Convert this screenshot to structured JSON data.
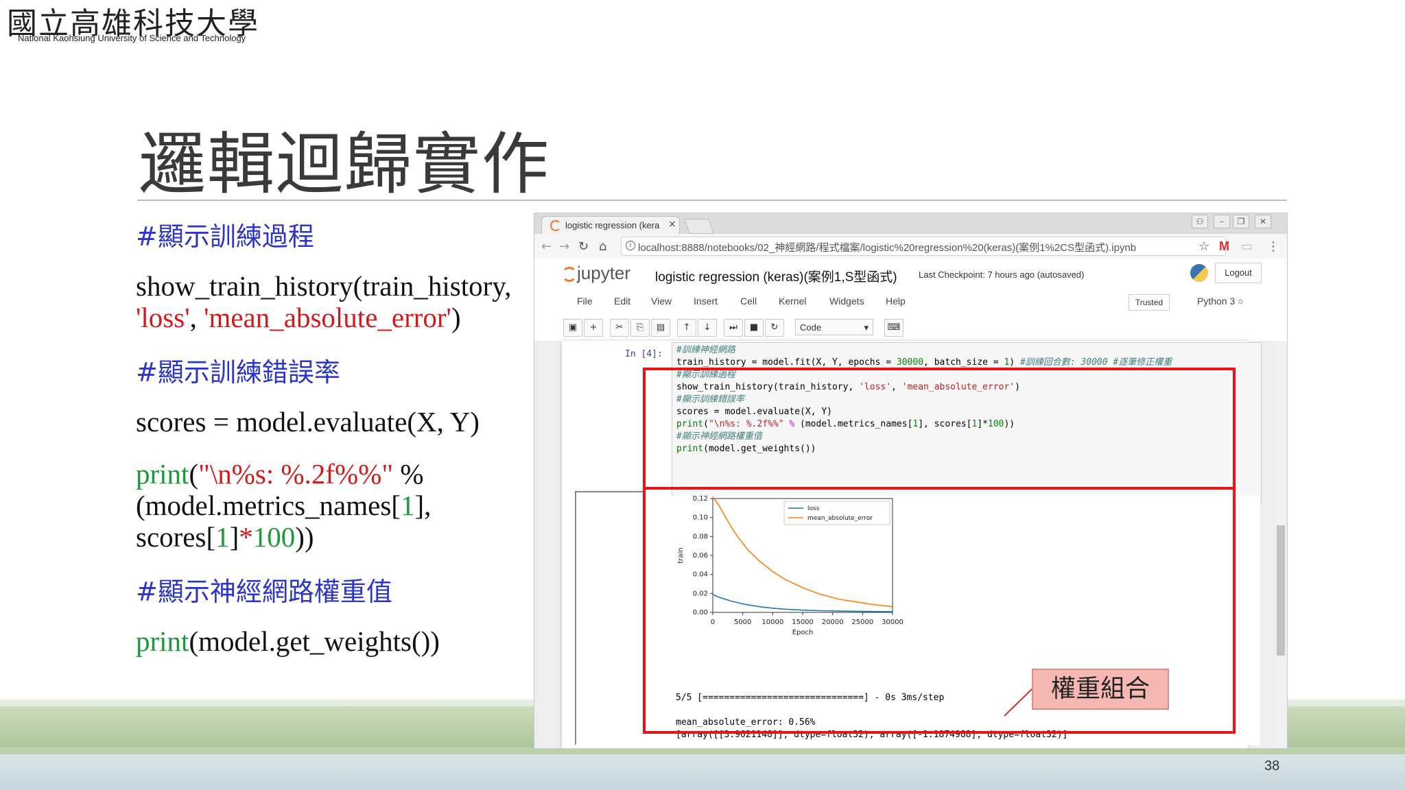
{
  "header": {
    "university_zh": "國立高雄科技大學",
    "university_en": "National Kaohsiung University of Science and Technology"
  },
  "slide": {
    "title": "邏輯迴歸實作",
    "page_number": "38",
    "comment1": "#顯示訓練過程",
    "line1": "show_train_history(train_history,",
    "line2_a": "'loss'",
    "line2_b": ", ",
    "line2_c": "'mean_absolute_error'",
    "line2_d": ")",
    "comment2": "#顯示訓練錯誤率",
    "line3": "scores = model.evaluate(X, Y)",
    "line4_a": "print",
    "line4_b": "(",
    "line4_c": "\"\\n%s: %.2f%%\"",
    "line4_d": " %",
    "line5_a": "(model.metrics_names[",
    "line5_b": "1",
    "line5_c": "],",
    "line6_a": "scores[",
    "line6_b": "1",
    "line6_c": "]",
    "line6_d": "*",
    "line6_e": "100",
    "line6_f": "))",
    "comment3": "#顯示神經網路權重值",
    "line7_a": "print",
    "line7_b": "(model.get_weights())",
    "callout": "權重組合"
  },
  "browser": {
    "tab_title": "logistic regression (kera",
    "tab_close": "×",
    "url": "localhost:8888/notebooks/02_神經網路/程式檔案/logistic%20regression%20(keras)(案例1%2CS型函式).ipynb",
    "url_info": "i",
    "jupyter_logo": "jupyter",
    "notebook_title": "logistic regression (keras)(案例1,S型函式)",
    "checkpoint": "Last Checkpoint: 7 hours ago (autosaved)",
    "logout": "Logout",
    "menus": [
      "File",
      "Edit",
      "View",
      "Insert",
      "Cell",
      "Kernel",
      "Widgets",
      "Help"
    ],
    "trusted": "Trusted",
    "kernel": "Python 3  ○",
    "cell_type": "Code",
    "cell_type_arrow": "▾",
    "toolbar_icons": [
      "save-icon",
      "plus-icon",
      "cut-icon",
      "copy-icon",
      "paste-icon",
      "arrow-up-icon",
      "arrow-down-icon",
      "step-forward-icon",
      "stop-icon",
      "refresh-icon",
      "keyboard-icon"
    ],
    "toolbar_glyphs": [
      "▣",
      "+",
      "✂",
      "⎘",
      "▤",
      "↑",
      "↓",
      "⏭",
      "■",
      "↻",
      "⌨"
    ]
  },
  "cell": {
    "prompt": "In [4]:",
    "code": [
      {
        "parts": [
          {
            "t": "#訓練神經網路",
            "c": "c-cm"
          }
        ]
      },
      {
        "parts": [
          {
            "t": "train_history = model.fit(X, Y, epochs = ",
            "c": ""
          },
          {
            "t": "30000",
            "c": "c-nm"
          },
          {
            "t": ", batch_size = ",
            "c": ""
          },
          {
            "t": "1",
            "c": "c-nm"
          },
          {
            "t": ")  ",
            "c": ""
          },
          {
            "t": "#訓練回合數: 30000   #逐筆修正權重",
            "c": "c-cm"
          }
        ]
      },
      {
        "parts": [
          {
            "t": "#顯示訓練過程",
            "c": "c-cm"
          }
        ]
      },
      {
        "parts": [
          {
            "t": "show_train_history(train_history, ",
            "c": ""
          },
          {
            "t": "'loss'",
            "c": "c-st"
          },
          {
            "t": ", ",
            "c": ""
          },
          {
            "t": "'mean_absolute_error'",
            "c": "c-st"
          },
          {
            "t": ")",
            "c": ""
          }
        ]
      },
      {
        "parts": [
          {
            "t": " ",
            "c": ""
          }
        ]
      },
      {
        "parts": [
          {
            "t": "#顯示訓練錯誤率",
            "c": "c-cm"
          }
        ]
      },
      {
        "parts": [
          {
            "t": "scores = model.evaluate(X, Y)",
            "c": ""
          }
        ]
      },
      {
        "parts": [
          {
            "t": "print",
            "c": "c-kw"
          },
          {
            "t": "(",
            "c": ""
          },
          {
            "t": "\"\\n%s: %.2f%%\"",
            "c": "c-st"
          },
          {
            "t": " % ",
            "c": "c-op"
          },
          {
            "t": "(model.metrics_names[",
            "c": ""
          },
          {
            "t": "1",
            "c": "c-nm"
          },
          {
            "t": "], scores[",
            "c": ""
          },
          {
            "t": "1",
            "c": "c-nm"
          },
          {
            "t": "]*",
            "c": ""
          },
          {
            "t": "100",
            "c": "c-nm"
          },
          {
            "t": "))",
            "c": ""
          }
        ]
      },
      {
        "parts": [
          {
            "t": " ",
            "c": ""
          }
        ]
      },
      {
        "parts": [
          {
            "t": "#顯示神經網路權重值",
            "c": "c-cm"
          }
        ]
      },
      {
        "parts": [
          {
            "t": "print",
            "c": "c-kw"
          },
          {
            "t": "(model.get_weights())",
            "c": ""
          }
        ]
      }
    ],
    "output_line1": "5/5 [==============================] - 0s 3ms/step",
    "output_line2": "mean_absolute_error: 0.56%",
    "output_line3": "[array([[3.9621148]], dtype=float32), array([-1.1874988], dtype=float32)]"
  },
  "chart_data": {
    "type": "line",
    "ylabel": "train",
    "xlabel": "Epoch",
    "xlim": [
      0,
      30000
    ],
    "ylim": [
      0,
      0.12
    ],
    "x_ticks": [
      0,
      5000,
      10000,
      15000,
      20000,
      25000,
      30000
    ],
    "y_ticks": [
      0.0,
      0.02,
      0.04,
      0.06,
      0.08,
      0.1,
      0.12
    ],
    "legend": "top-right",
    "series": [
      {
        "name": "loss",
        "color": "#1f77b4",
        "x": [
          0,
          1000,
          2000,
          3000,
          4000,
          5000,
          6000,
          8000,
          10000,
          12000,
          15000,
          18000,
          21000,
          24000,
          27000,
          30000
        ],
        "values": [
          0.019,
          0.016,
          0.014,
          0.012,
          0.0105,
          0.009,
          0.0078,
          0.0058,
          0.0044,
          0.0034,
          0.0024,
          0.0018,
          0.0014,
          0.0011,
          0.0009,
          0.0008
        ]
      },
      {
        "name": "mean_absolute_error",
        "color": "#ff7f0e",
        "x": [
          0,
          1000,
          2000,
          3000,
          4000,
          5000,
          6000,
          8000,
          10000,
          12000,
          15000,
          18000,
          21000,
          24000,
          27000,
          30000
        ],
        "values": [
          0.122,
          0.113,
          0.102,
          0.091,
          0.081,
          0.073,
          0.065,
          0.053,
          0.043,
          0.035,
          0.026,
          0.019,
          0.014,
          0.011,
          0.008,
          0.006
        ]
      }
    ]
  }
}
